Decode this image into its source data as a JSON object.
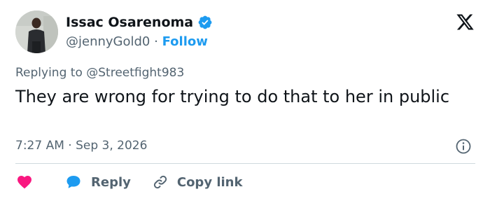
{
  "user": {
    "display_name": "Issac Osarenoma",
    "handle": "@jennyGold0",
    "separator": "·",
    "follow_label": "Follow"
  },
  "tweet": {
    "replying_prefix": "Replying to ",
    "replying_to": "@Streetfight983",
    "text": "They are wrong for trying to do that to her in public",
    "timestamp": "7:27 AM · Sep 3, 2026"
  },
  "actions": {
    "reply_label": "Reply",
    "copy_link_label": "Copy link"
  },
  "icons": {
    "brand": "x-logo-icon",
    "verified": "verified-badge-icon",
    "info": "info-icon",
    "like": "heart-icon",
    "reply": "speech-bubble-icon",
    "copy": "link-icon"
  },
  "colors": {
    "accent": "#1d9bf0",
    "like": "#f91880",
    "text": "#0f1419",
    "muted": "#536471"
  }
}
